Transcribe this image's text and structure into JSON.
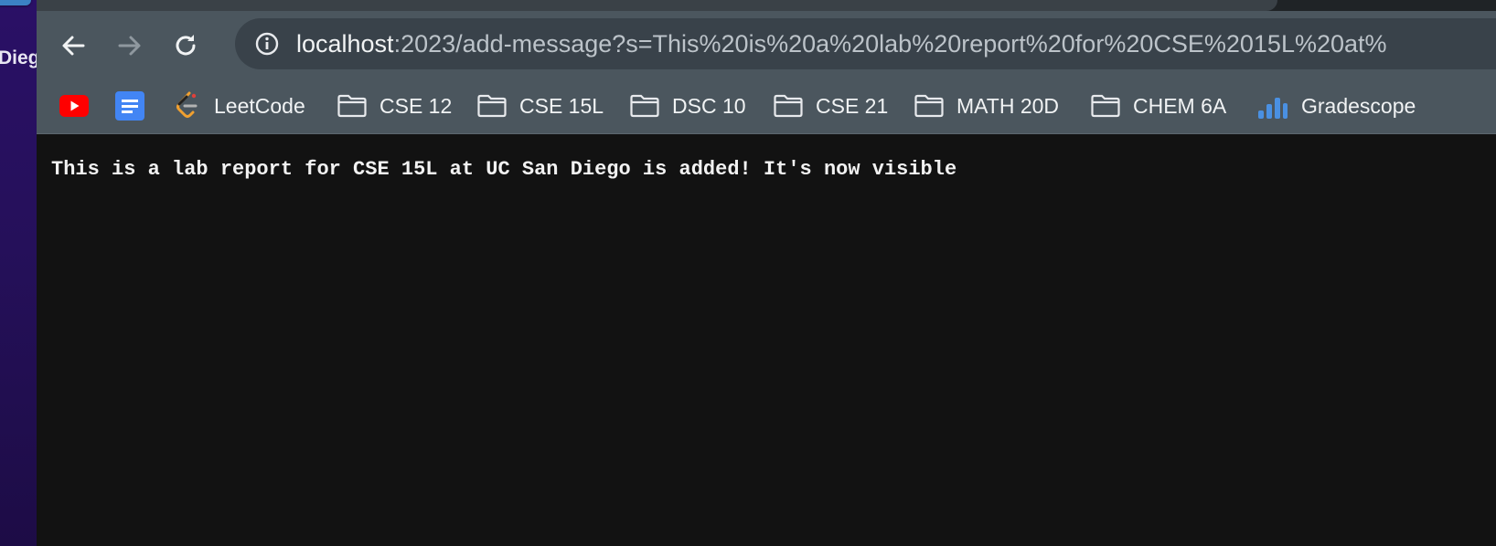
{
  "desktop": {
    "partial_label": "Dieg"
  },
  "toolbar": {
    "back_icon": "arrow-left-icon",
    "forward_icon": "arrow-right-icon",
    "reload_icon": "reload-icon",
    "info_icon": "info-icon"
  },
  "address_bar": {
    "host": "localhost",
    "rest": ":2023/add-message?s=This%20is%20a%20lab%20report%20for%20CSE%2015L%20at%"
  },
  "bookmarks": [
    {
      "label": "",
      "icon": "youtube-icon"
    },
    {
      "label": "",
      "icon": "google-docs-icon"
    },
    {
      "label": "LeetCode",
      "icon": "leetcode-icon"
    },
    {
      "label": "CSE 12",
      "icon": "folder-icon"
    },
    {
      "label": "CSE 15L",
      "icon": "folder-icon"
    },
    {
      "label": "DSC 10",
      "icon": "folder-icon"
    },
    {
      "label": "CSE 21",
      "icon": "folder-icon"
    },
    {
      "label": "MATH 20D",
      "icon": "folder-icon"
    },
    {
      "label": "CHEM 6A",
      "icon": "folder-icon"
    },
    {
      "label": "Gradescope",
      "icon": "gradescope-icon"
    }
  ],
  "page": {
    "message": "This is a lab report for CSE 15L at UC San Diego is added! It's now visible"
  },
  "colors": {
    "toolbar": "#4b565e",
    "omnibox": "#39424a",
    "page_background": "#121212",
    "youtube_red": "#ff0000",
    "docs_blue": "#4285f4",
    "gradescope_blue": "#4a90e2"
  }
}
